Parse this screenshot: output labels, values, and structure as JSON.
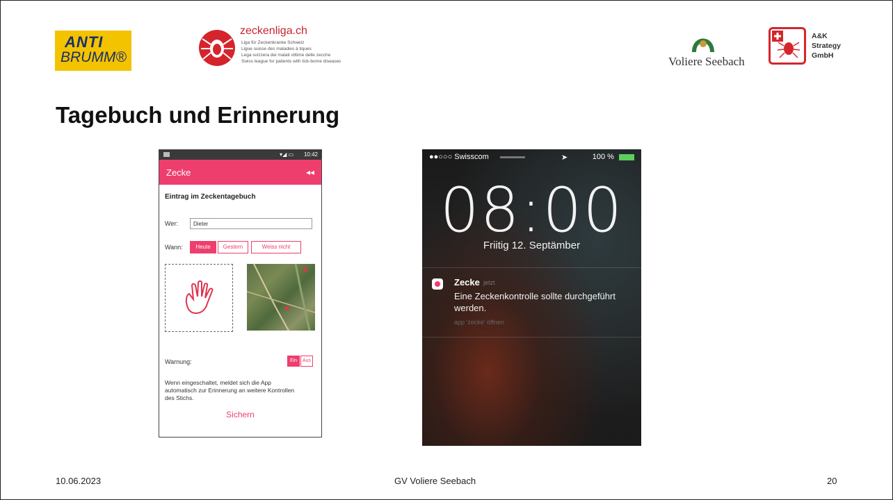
{
  "logos": {
    "antibrumm": {
      "line1": "ANTI",
      "line2": "BRUMM®"
    },
    "zeckenliga": {
      "title": "zeckenliga.ch",
      "lines": [
        "Liga für Zeckenkranke Schweiz",
        "Ligue suisse des maladies à tiques",
        "Lega svizzera dei malati vittime delle zecche",
        "Swiss league for patients with tick-borne diseases"
      ]
    },
    "voliere": {
      "text": "Voliere Seebach"
    },
    "ak": {
      "line1": "A&K",
      "line2": "Strategy",
      "line3": "GmbH"
    }
  },
  "slide": {
    "title": "Tagebuch und Erinnerung"
  },
  "android": {
    "status_time": "10:42",
    "app_title": "Zecke",
    "back_icon": "◂◂",
    "heading": "Eintrag im Zeckentagebuch",
    "wer_label": "Wer:",
    "wer_value": "Dieter",
    "wann_label": "Wann:",
    "wann_options": [
      "Heute",
      "Gestern",
      "Weiss nicht"
    ],
    "warnung_label": "Warnung:",
    "toggle_on": "Ein",
    "toggle_off": "Aus",
    "description": "Wenn eingeschaltet, meldet sich die App automatisch zur Erinnerung an weitere Kontrollen des Stichs.",
    "save_label": "Sichern"
  },
  "ios": {
    "carrier": "●●○○○ Swisscom",
    "battery": "100 %",
    "time": "08:00",
    "date": "Friitig 12. Septämber",
    "app_name": "Zecke",
    "when": "jetzt",
    "message": "Eine Zeckenkontrolle sollte durchgeführt werden.",
    "open_hint": "app 'zecke' öffnen"
  },
  "footer": {
    "date": "10.06.2023",
    "center": "GV Voliere Seebach",
    "page": "20"
  },
  "colors": {
    "accent": "#ee3e6d",
    "antibrumm_bg": "#f3c300",
    "ak_red": "#d4262d"
  }
}
